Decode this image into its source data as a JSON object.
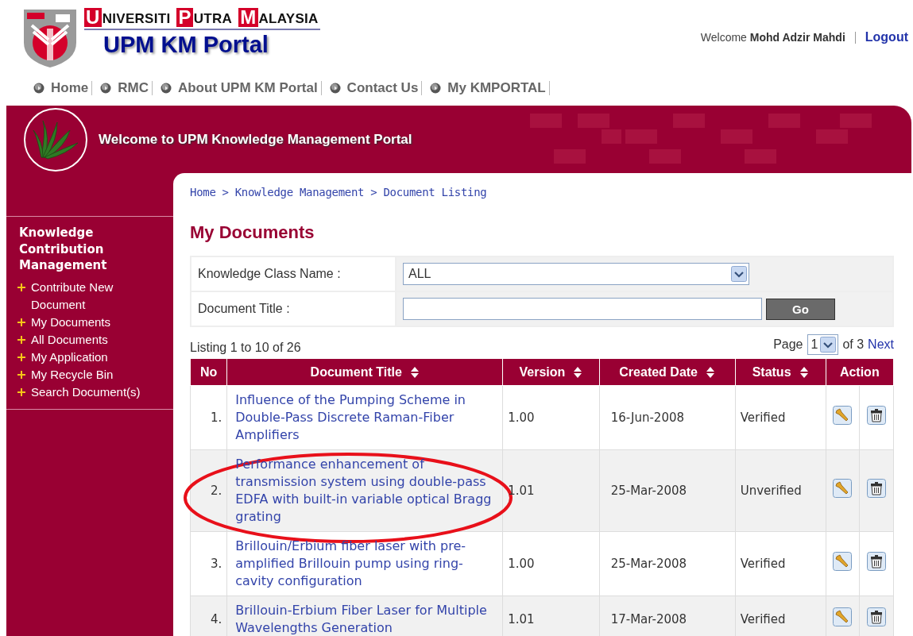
{
  "header": {
    "wordmark": [
      "UNIVERSITI",
      "PUTRA",
      "MALAYSIA"
    ],
    "portal_title": "UPM KM Portal",
    "welcome": "Welcome",
    "user": "Mohd Adzir Mahdi",
    "logout": "Logout"
  },
  "nav": [
    "Home",
    "RMC",
    "About UPM KM Portal",
    "Contact Us",
    "My KMPORTAL"
  ],
  "banner": {
    "title": "Welcome to UPM Knowledge Management Portal"
  },
  "sidebar": {
    "heading": "Knowledge Contribution Management",
    "items": [
      "Contribute New Document",
      "My Documents",
      "All Documents",
      "My Application",
      "My Recycle Bin",
      "Search Document(s)"
    ]
  },
  "breadcrumb": {
    "separator": ">",
    "items": [
      "Home",
      "Knowledge Management",
      "Document Listing"
    ]
  },
  "page_title": "My Documents",
  "filters": [
    {
      "kind": "select",
      "label": "Knowledge Class Name :",
      "value": "ALL"
    },
    {
      "kind": "text",
      "label": "Document Title :",
      "button": "Go"
    }
  ],
  "listing": "Listing 1 to 10 of 26",
  "pager": {
    "label": "Page",
    "value": "1",
    "of": "of 3",
    "next": "Next"
  },
  "table": {
    "columns": [
      {
        "label": "No",
        "sortable": false
      },
      {
        "label": "Document Title",
        "sortable": true
      },
      {
        "label": "Version",
        "sortable": true
      },
      {
        "label": "Created Date",
        "sortable": true
      },
      {
        "label": "Status",
        "sortable": true
      },
      {
        "label": "Action",
        "sortable": false
      }
    ],
    "rows": [
      {
        "no": "1.",
        "title": "Influence of the Pumping Scheme in Double-Pass Discrete Raman-Fiber Amplifiers",
        "version": "1.00",
        "date": "16-Jun-2008",
        "status": "Verified",
        "circled": false
      },
      {
        "no": "2.",
        "title": "Performance enhancement of transmission system using double-pass EDFA with built-in variable optical Bragg grating",
        "version": "1.01",
        "date": "25-Mar-2008",
        "status": "Unverified",
        "circled": true
      },
      {
        "no": "3.",
        "title": "Brillouin/Erbium fiber laser with pre-amplified Brillouin pump using ring-cavity configuration",
        "version": "1.00",
        "date": "25-Mar-2008",
        "status": "Verified",
        "circled": false
      },
      {
        "no": "4.",
        "title": "Brillouin-Erbium Fiber Laser for Multiple Wavelengths Generation",
        "version": "1.01",
        "date": "17-Mar-2008",
        "status": "Verified",
        "circled": false
      }
    ]
  }
}
